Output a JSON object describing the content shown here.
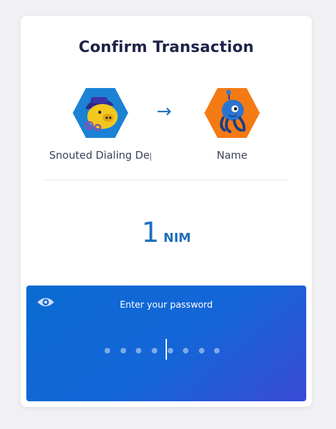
{
  "dialog": {
    "title": "Confirm Transaction"
  },
  "sender": {
    "label": "Snouted Dialing Dep",
    "identicon": "pig-robot-identicon"
  },
  "recipient": {
    "label": "Name",
    "identicon": "octopus-identicon"
  },
  "transfer_arrow": "→",
  "amount": {
    "value": "1",
    "unit": "NIM"
  },
  "password": {
    "label": "Enter your password",
    "masked_length": 8,
    "eye_icon": "eye-icon"
  },
  "colors": {
    "accent": "#1f6fbd",
    "title": "#1f2348",
    "panel_start": "#0a6bd2",
    "panel_end": "#3a4ad6"
  }
}
